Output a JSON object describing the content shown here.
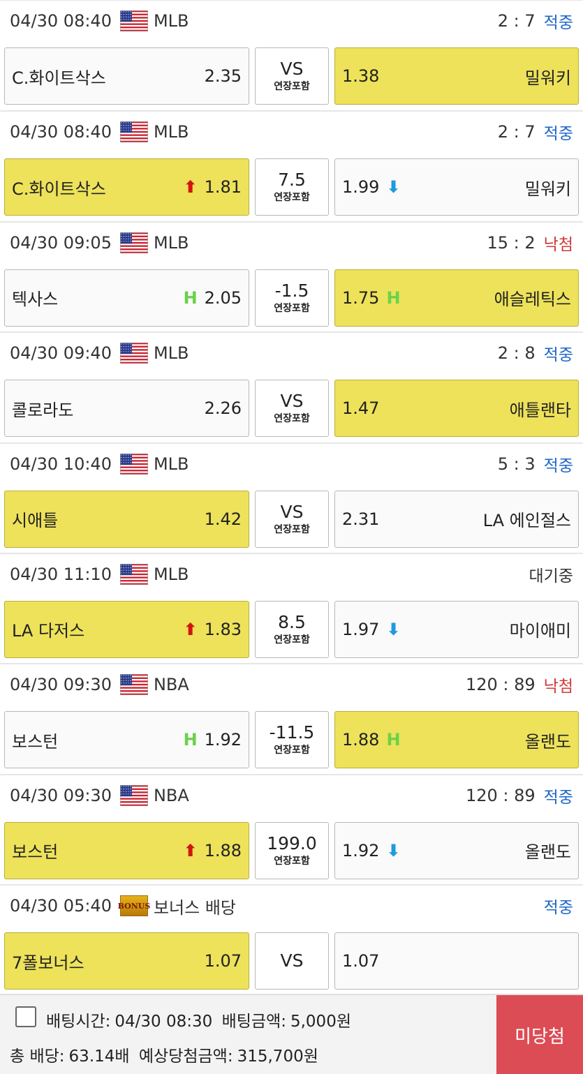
{
  "mid_sublabel": "연장포함",
  "colors": {
    "selected": "#ede25a",
    "hit": "#1e66c8",
    "miss": "#d03a3a",
    "result_button": "#dc4c54"
  },
  "icons": {
    "flag": "us-flag-icon",
    "up": "up-arrow-icon",
    "down": "down-arrow-icon",
    "handicap": "handicap-h-icon",
    "bonus": "bonus-badge-icon"
  },
  "bets": [
    {
      "date": "04/30 08:40",
      "league": "MLB",
      "score": "2 : 7",
      "status": "적중",
      "status_type": "hit",
      "home": {
        "name": "C.화이트삭스",
        "odds": "2.35",
        "mark": ""
      },
      "mid": "VS",
      "mid_sub": true,
      "away": {
        "name": "밀워키",
        "odds": "1.38",
        "mark": ""
      },
      "selected": "away"
    },
    {
      "date": "04/30 08:40",
      "league": "MLB",
      "score": "2 : 7",
      "status": "적중",
      "status_type": "hit",
      "home": {
        "name": "C.화이트삭스",
        "odds": "1.81",
        "mark": "up"
      },
      "mid": "7.5",
      "mid_sub": true,
      "away": {
        "name": "밀워키",
        "odds": "1.99",
        "mark": "down"
      },
      "selected": "home"
    },
    {
      "date": "04/30 09:05",
      "league": "MLB",
      "score": "15 : 2",
      "status": "낙첨",
      "status_type": "miss",
      "home": {
        "name": "텍사스",
        "odds": "2.05",
        "mark": "h"
      },
      "mid": "-1.5",
      "mid_sub": true,
      "away": {
        "name": "애슬레틱스",
        "odds": "1.75",
        "mark": "h"
      },
      "selected": "away"
    },
    {
      "date": "04/30 09:40",
      "league": "MLB",
      "score": "2 : 8",
      "status": "적중",
      "status_type": "hit",
      "home": {
        "name": "콜로라도",
        "odds": "2.26",
        "mark": ""
      },
      "mid": "VS",
      "mid_sub": true,
      "away": {
        "name": "애틀랜타",
        "odds": "1.47",
        "mark": ""
      },
      "selected": "away"
    },
    {
      "date": "04/30 10:40",
      "league": "MLB",
      "score": "5 : 3",
      "status": "적중",
      "status_type": "hit",
      "home": {
        "name": "시애틀",
        "odds": "1.42",
        "mark": ""
      },
      "mid": "VS",
      "mid_sub": true,
      "away": {
        "name": "LA 에인절스",
        "odds": "2.31",
        "mark": ""
      },
      "selected": "home"
    },
    {
      "date": "04/30 11:10",
      "league": "MLB",
      "score": "",
      "status": "대기중",
      "status_type": "wait",
      "home": {
        "name": "LA 다저스",
        "odds": "1.83",
        "mark": "up"
      },
      "mid": "8.5",
      "mid_sub": true,
      "away": {
        "name": "마이애미",
        "odds": "1.97",
        "mark": "down"
      },
      "selected": "home"
    },
    {
      "date": "04/30 09:30",
      "league": "NBA",
      "score": "120 : 89",
      "status": "낙첨",
      "status_type": "miss",
      "home": {
        "name": "보스턴",
        "odds": "1.92",
        "mark": "h"
      },
      "mid": "-11.5",
      "mid_sub": true,
      "away": {
        "name": "올랜도",
        "odds": "1.88",
        "mark": "h"
      },
      "selected": "away"
    },
    {
      "date": "04/30 09:30",
      "league": "NBA",
      "score": "120 : 89",
      "status": "적중",
      "status_type": "hit",
      "home": {
        "name": "보스턴",
        "odds": "1.88",
        "mark": "up"
      },
      "mid": "199.0",
      "mid_sub": true,
      "away": {
        "name": "올랜도",
        "odds": "1.92",
        "mark": "down"
      },
      "selected": "home"
    },
    {
      "date": "04/30 05:40",
      "league": "보너스 배당",
      "badge": "bonus",
      "badge_text": "BONUS",
      "score": "",
      "status": "적중",
      "status_type": "hit",
      "home": {
        "name": "7폴보너스",
        "odds": "1.07",
        "mark": ""
      },
      "mid": "VS",
      "mid_sub": false,
      "away": {
        "name": "",
        "odds": "1.07",
        "mark": ""
      },
      "selected": "home"
    }
  ],
  "footer": {
    "bet_time_label": "배팅시간:",
    "bet_time": "04/30 08:30",
    "bet_amount_label": "배팅금액:",
    "bet_amount": "5,000원",
    "total_odds_label": "총 배당:",
    "total_odds": "63.14배",
    "expected_label": "예상당첨금액:",
    "expected": "315,700원",
    "result_button": "미당첨"
  }
}
